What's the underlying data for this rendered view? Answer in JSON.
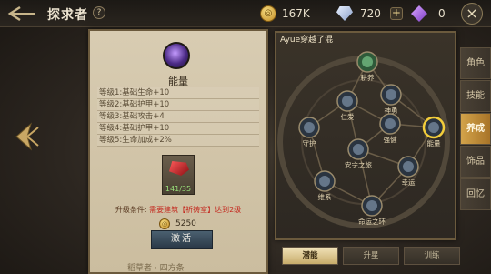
{
  "header": {
    "title": "探求者",
    "help_label": "?"
  },
  "resources": [
    {
      "name": "coin",
      "icon": "coin-icon",
      "value": "167K"
    },
    {
      "name": "crystal",
      "icon": "crystal-icon",
      "value": "720"
    },
    {
      "name": "rune",
      "icon": "rune-icon",
      "value": "0"
    }
  ],
  "plus_label": "+",
  "close_label": "×",
  "detail": {
    "skill_name": "能量",
    "levels": [
      "等级1:基础生命+10",
      "等级2:基础护甲+10",
      "等级3:基础攻击+4",
      "等级4:基础护甲+10",
      "等级5:生命加成+2%"
    ],
    "item_count": "141/35",
    "upgrade_label": "升级条件:",
    "upgrade_req": "需要建筑【祈祷室】达到2级",
    "cost": "5250",
    "activate_label": "激活",
    "under_text": "稻草者 · 四方条"
  },
  "tree": {
    "title": "Ayue穿越了混",
    "nodes": [
      {
        "label": "耕养"
      },
      {
        "label": "神勇"
      },
      {
        "label": "仁爱"
      },
      {
        "label": "守护"
      },
      {
        "label": "强健"
      },
      {
        "label": "能量"
      },
      {
        "label": "安宁之旅"
      },
      {
        "label": "维系"
      },
      {
        "label": "幸运"
      },
      {
        "label": "命运之环"
      }
    ]
  },
  "side_tabs": [
    {
      "label": "角色",
      "active": false
    },
    {
      "label": "技能",
      "active": false
    },
    {
      "label": "养成",
      "active": true
    },
    {
      "label": "饰品",
      "active": false
    },
    {
      "label": "回忆",
      "active": false
    }
  ],
  "bottom_tabs": [
    {
      "label": "潜能",
      "active": true
    },
    {
      "label": "升星",
      "active": false
    },
    {
      "label": "训练",
      "active": false
    }
  ],
  "colors": {
    "accent": "#d3a34a",
    "required": "#c4281e",
    "panel": "#d8ccb2"
  }
}
